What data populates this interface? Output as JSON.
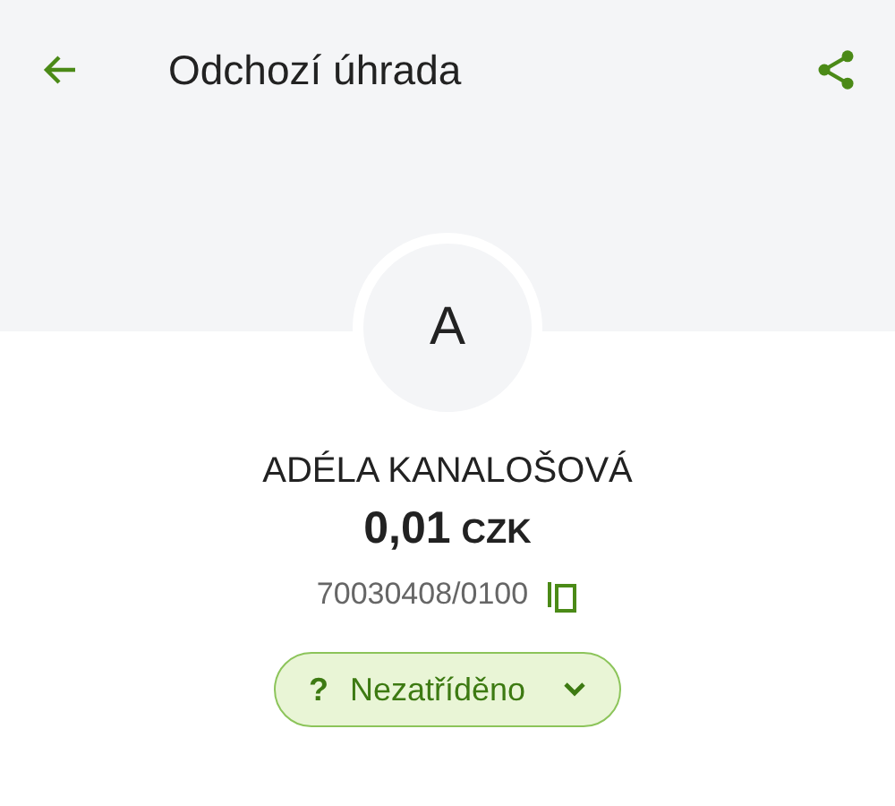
{
  "header": {
    "title": "Odchozí úhrada"
  },
  "avatar": {
    "initial": "A"
  },
  "payment": {
    "name": "ADÉLA KANALOŠOVÁ",
    "amount": "0,01",
    "currency": "CZK",
    "account": "70030408/0100"
  },
  "category": {
    "icon": "?",
    "label": "Nezatříděno"
  }
}
